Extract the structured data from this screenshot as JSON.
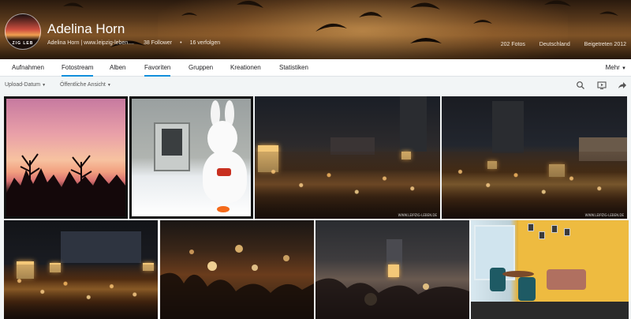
{
  "profile": {
    "name": "Adelina Horn",
    "subtitle": "Adelina Horn | www.leipzig-leben....",
    "followers": "38 Follower",
    "dot": "•",
    "following": "16 verfolgen",
    "avatar_text": "ZIG LEB",
    "photos": "202 Fotos",
    "country": "Deutschland",
    "joined": "Beigetreten 2012"
  },
  "nav": {
    "tabs": [
      {
        "label": "Aufnahmen"
      },
      {
        "label": "Fotostream"
      },
      {
        "label": "Alben"
      },
      {
        "label": "Favoriten"
      },
      {
        "label": "Gruppen"
      },
      {
        "label": "Kreationen"
      },
      {
        "label": "Statistiken"
      }
    ],
    "active_index": 1,
    "more_label": "Mehr"
  },
  "toolbar": {
    "sort_label": "Upload-Datum",
    "view_label": "Öffentliche Ansicht"
  },
  "photos": {
    "watermark": "WWW.LEIPZIG-LEBEN.DE"
  },
  "colors": {
    "accent": "#128fdc",
    "nav_bg": "#ffffff",
    "page_bg": "#f2f5f6"
  }
}
